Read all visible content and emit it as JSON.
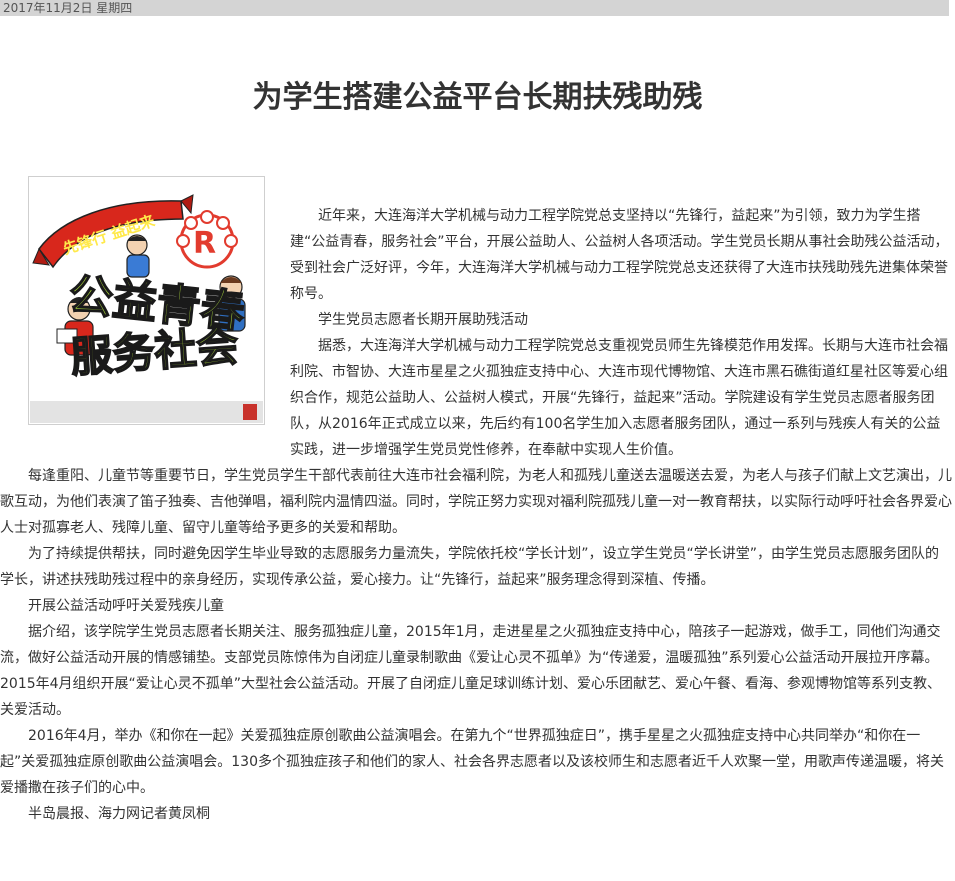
{
  "header": {
    "date": "2017年11月2日 星期四"
  },
  "article": {
    "title": "为学生搭建公益平台长期扶残助残",
    "paragraphs": [
      "近年来，大连海洋大学机械与动力工程学院党总支坚持以“先锋行，益起来”为引领，致力为学生搭建“公益青春，服务社会”平台，开展公益助人、公益树人各项活动。学生党员长期从事社会助残公益活动，受到社会广泛好评，今年，大连海洋大学机械与动力工程学院党总支还获得了大连市扶残助残先进集体荣誉称号。",
      "学生党员志愿者长期开展助残活动",
      "据悉，大连海洋大学机械与动力工程学院党总支重视党员师生先锋模范作用发挥。长期与大连市社会福利院、市智协、大连市星星之火孤独症支持中心、大连市现代博物馆、大连市黑石礁街道红星社区等爱心组织合作，规范公益助人、公益树人模式，开展“先锋行，益起来”活动。学院建设有学生党员志愿者服务团队，从2016年正式成立以来，先后约有100名学生加入志愿者服务团队，通过一系列与残疾人有关的公益实践，进一步增强学生党员党性修养，在奉献中实现人生价值。",
      "每逢重阳、儿童节等重要节日，学生党员学生干部代表前往大连市社会福利院，为老人和孤残儿童送去温暖送去爱，为老人与孩子们献上文艺演出，儿歌互动，为他们表演了笛子独奏、吉他弹唱，福利院内温情四溢。同时，学院正努力实现对福利院孤残儿童一对一教育帮扶，以实际行动呼吁社会各界爱心人士对孤寡老人、残障儿童、留守儿童等给予更多的关爱和帮助。",
      "为了持续提供帮扶，同时避免因学生毕业导致的志愿服务力量流失，学院依托校“学长计划”，设立学生党员“学长讲堂”，由学生党员志愿服务团队的学长，讲述扶残助残过程中的亲身经历，实现传承公益，爱心接力。让“先锋行，益起来”服务理念得到深植、传播。",
      "开展公益活动呼吁关爱残疾儿童",
      "据介绍，该学院学生党员志愿者长期关注、服务孤独症儿童，2015年1月，走进星星之火孤独症支持中心，陪孩子一起游戏，做手工，同他们沟通交流，做好公益活动开展的情感铺垫。支部党员陈惊伟为自闭症儿童录制歌曲《爱让心灵不孤单》为“传递爱，温暖孤独”系列爱心公益活动开展拉开序幕。2015年4月组织开展“爱让心灵不孤单”大型社会公益活动。开展了自闭症儿童足球训练计划、爱心乐团献艺、爱心午餐、看海、参观博物馆等系列支教、关爱活动。",
      "2016年4月，举办《和你在一起》关爱孤独症原创歌曲公益演唱会。在第九个“世界孤独症日”，携手星星之火孤独症支持中心共同举办“和你在一起”关爱孤独症原创歌曲公益演唱会。130多个孤独症孩子和他们的家人、社会各界志愿者以及该校师生和志愿者近千人欢聚一堂，用歌声传递温暖，将关爱播撒在孩子们的心中。",
      "半岛晨报、海力网记者黄凤桐"
    ]
  },
  "poster": {
    "banner_text": "先锋行 益起来",
    "slogan_line1": "公益青春",
    "slogan_line2": "服务社会",
    "colors": {
      "banner": "#d8271c",
      "slogan": "#a6d23a",
      "slogan_outline": "#1a1a1a",
      "emblem": "#e23b2e"
    }
  },
  "colors": {
    "date_bar_bg": "#d4d4d4",
    "text": "#333333",
    "accent_block": "#c8322b"
  }
}
